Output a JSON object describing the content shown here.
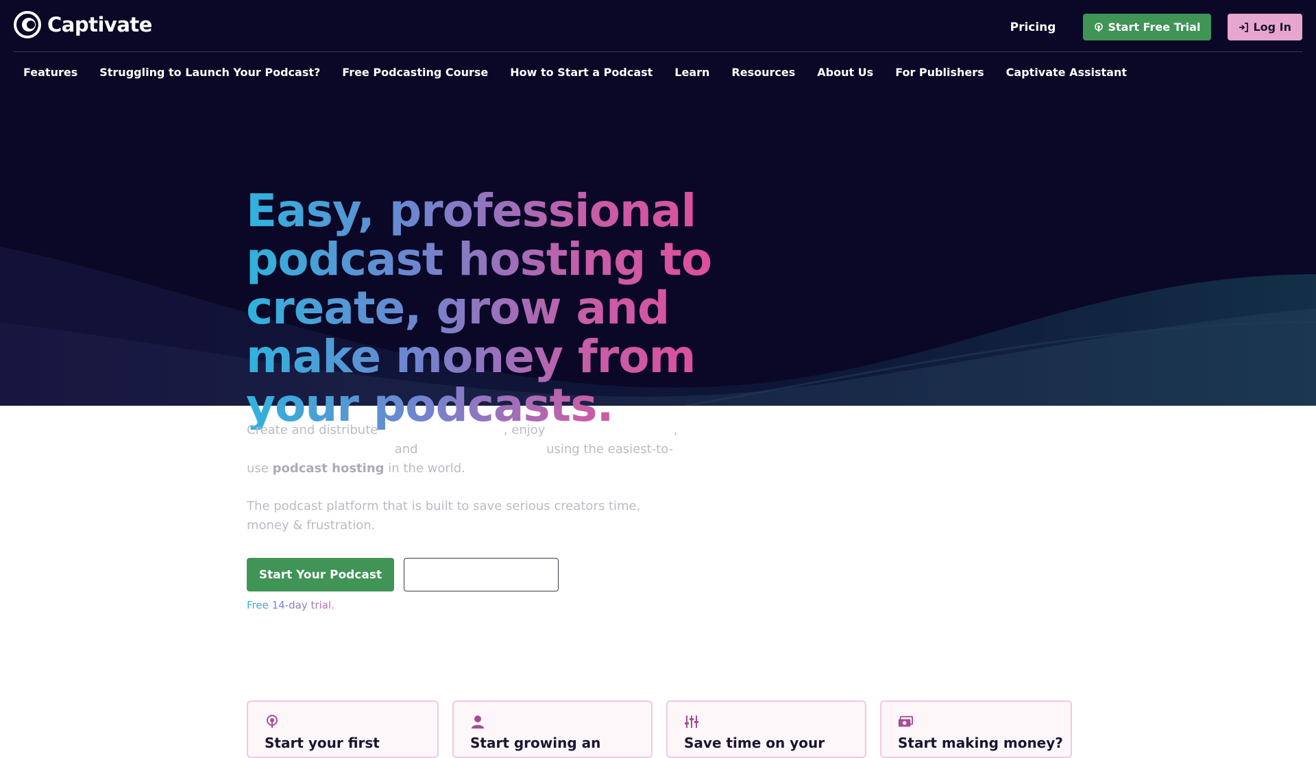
{
  "brand": {
    "name": "Captivate"
  },
  "header": {
    "pricing": "Pricing",
    "trial_button": "Start Free Trial",
    "login_button": "Log In"
  },
  "nav": {
    "items": [
      "Features",
      "Struggling to Launch Your Podcast?",
      "Free Podcasting Course",
      "How to Start a Podcast",
      "Learn",
      "Resources",
      "About Us",
      "For Publishers",
      "Captivate Assistant"
    ]
  },
  "hero": {
    "headline": "Easy, professional podcast hosting to create, grow and make money from your podcasts.",
    "intro_1": "Create and distribute",
    "intro_2": ", enjoy",
    "intro_3": ",",
    "intro_4": "and",
    "intro_5": "using the easiest-to-use",
    "intro_bold": "podcast hosting",
    "intro_6": "in the world.",
    "tagline": "The podcast platform that is built to save serious creators time, money & frustration.",
    "cta": "Start Your Podcast",
    "note": "Free 14-day trial."
  },
  "cards": [
    {
      "title": "Start your first",
      "icon": "podcast-icon"
    },
    {
      "title": "Start growing an",
      "icon": "user-icon"
    },
    {
      "title": "Save time on your",
      "icon": "sliders-icon"
    },
    {
      "title": "Start making money?",
      "icon": "money-icon"
    }
  ],
  "colors": {
    "hero_bg": "#0a0826",
    "green": "#3f9456",
    "pink": "#e7a6cf",
    "card_border": "#f0c9df"
  }
}
